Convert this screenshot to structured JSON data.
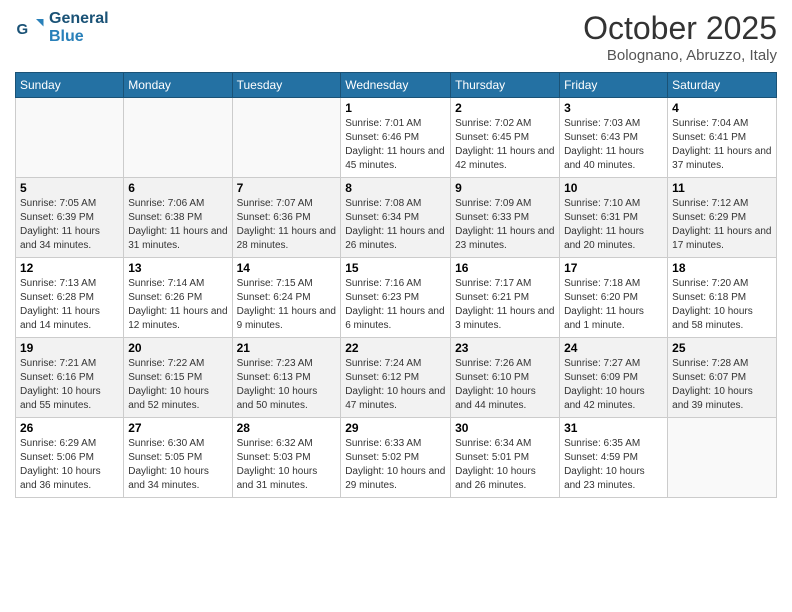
{
  "header": {
    "logo_general": "General",
    "logo_blue": "Blue",
    "month_title": "October 2025",
    "location": "Bolognano, Abruzzo, Italy"
  },
  "days_of_week": [
    "Sunday",
    "Monday",
    "Tuesday",
    "Wednesday",
    "Thursday",
    "Friday",
    "Saturday"
  ],
  "weeks": [
    [
      {
        "day": "",
        "info": ""
      },
      {
        "day": "",
        "info": ""
      },
      {
        "day": "",
        "info": ""
      },
      {
        "day": "1",
        "info": "Sunrise: 7:01 AM\nSunset: 6:46 PM\nDaylight: 11 hours and 45 minutes."
      },
      {
        "day": "2",
        "info": "Sunrise: 7:02 AM\nSunset: 6:45 PM\nDaylight: 11 hours and 42 minutes."
      },
      {
        "day": "3",
        "info": "Sunrise: 7:03 AM\nSunset: 6:43 PM\nDaylight: 11 hours and 40 minutes."
      },
      {
        "day": "4",
        "info": "Sunrise: 7:04 AM\nSunset: 6:41 PM\nDaylight: 11 hours and 37 minutes."
      }
    ],
    [
      {
        "day": "5",
        "info": "Sunrise: 7:05 AM\nSunset: 6:39 PM\nDaylight: 11 hours and 34 minutes."
      },
      {
        "day": "6",
        "info": "Sunrise: 7:06 AM\nSunset: 6:38 PM\nDaylight: 11 hours and 31 minutes."
      },
      {
        "day": "7",
        "info": "Sunrise: 7:07 AM\nSunset: 6:36 PM\nDaylight: 11 hours and 28 minutes."
      },
      {
        "day": "8",
        "info": "Sunrise: 7:08 AM\nSunset: 6:34 PM\nDaylight: 11 hours and 26 minutes."
      },
      {
        "day": "9",
        "info": "Sunrise: 7:09 AM\nSunset: 6:33 PM\nDaylight: 11 hours and 23 minutes."
      },
      {
        "day": "10",
        "info": "Sunrise: 7:10 AM\nSunset: 6:31 PM\nDaylight: 11 hours and 20 minutes."
      },
      {
        "day": "11",
        "info": "Sunrise: 7:12 AM\nSunset: 6:29 PM\nDaylight: 11 hours and 17 minutes."
      }
    ],
    [
      {
        "day": "12",
        "info": "Sunrise: 7:13 AM\nSunset: 6:28 PM\nDaylight: 11 hours and 14 minutes."
      },
      {
        "day": "13",
        "info": "Sunrise: 7:14 AM\nSunset: 6:26 PM\nDaylight: 11 hours and 12 minutes."
      },
      {
        "day": "14",
        "info": "Sunrise: 7:15 AM\nSunset: 6:24 PM\nDaylight: 11 hours and 9 minutes."
      },
      {
        "day": "15",
        "info": "Sunrise: 7:16 AM\nSunset: 6:23 PM\nDaylight: 11 hours and 6 minutes."
      },
      {
        "day": "16",
        "info": "Sunrise: 7:17 AM\nSunset: 6:21 PM\nDaylight: 11 hours and 3 minutes."
      },
      {
        "day": "17",
        "info": "Sunrise: 7:18 AM\nSunset: 6:20 PM\nDaylight: 11 hours and 1 minute."
      },
      {
        "day": "18",
        "info": "Sunrise: 7:20 AM\nSunset: 6:18 PM\nDaylight: 10 hours and 58 minutes."
      }
    ],
    [
      {
        "day": "19",
        "info": "Sunrise: 7:21 AM\nSunset: 6:16 PM\nDaylight: 10 hours and 55 minutes."
      },
      {
        "day": "20",
        "info": "Sunrise: 7:22 AM\nSunset: 6:15 PM\nDaylight: 10 hours and 52 minutes."
      },
      {
        "day": "21",
        "info": "Sunrise: 7:23 AM\nSunset: 6:13 PM\nDaylight: 10 hours and 50 minutes."
      },
      {
        "day": "22",
        "info": "Sunrise: 7:24 AM\nSunset: 6:12 PM\nDaylight: 10 hours and 47 minutes."
      },
      {
        "day": "23",
        "info": "Sunrise: 7:26 AM\nSunset: 6:10 PM\nDaylight: 10 hours and 44 minutes."
      },
      {
        "day": "24",
        "info": "Sunrise: 7:27 AM\nSunset: 6:09 PM\nDaylight: 10 hours and 42 minutes."
      },
      {
        "day": "25",
        "info": "Sunrise: 7:28 AM\nSunset: 6:07 PM\nDaylight: 10 hours and 39 minutes."
      }
    ],
    [
      {
        "day": "26",
        "info": "Sunrise: 6:29 AM\nSunset: 5:06 PM\nDaylight: 10 hours and 36 minutes."
      },
      {
        "day": "27",
        "info": "Sunrise: 6:30 AM\nSunset: 5:05 PM\nDaylight: 10 hours and 34 minutes."
      },
      {
        "day": "28",
        "info": "Sunrise: 6:32 AM\nSunset: 5:03 PM\nDaylight: 10 hours and 31 minutes."
      },
      {
        "day": "29",
        "info": "Sunrise: 6:33 AM\nSunset: 5:02 PM\nDaylight: 10 hours and 29 minutes."
      },
      {
        "day": "30",
        "info": "Sunrise: 6:34 AM\nSunset: 5:01 PM\nDaylight: 10 hours and 26 minutes."
      },
      {
        "day": "31",
        "info": "Sunrise: 6:35 AM\nSunset: 4:59 PM\nDaylight: 10 hours and 23 minutes."
      },
      {
        "day": "",
        "info": ""
      }
    ]
  ]
}
